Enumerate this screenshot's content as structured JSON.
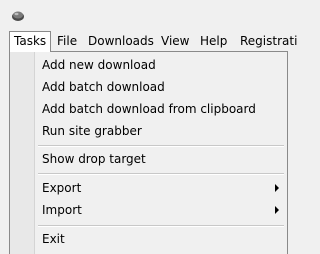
{
  "app": {
    "icon": "app-gear-icon"
  },
  "menubar": {
    "items": [
      "Tasks",
      "File",
      "Downloads",
      "View",
      "Help",
      "Registrati"
    ],
    "active": "Tasks"
  },
  "dropdown": {
    "items": [
      {
        "label": "Add new download",
        "submenu": false
      },
      {
        "label": "Add batch download",
        "submenu": false
      },
      {
        "label": "Add batch download from clipboard",
        "submenu": false
      },
      {
        "label": "Run site grabber",
        "submenu": false
      },
      {
        "label": "Show drop target",
        "submenu": false
      },
      {
        "label": "Export",
        "submenu": true,
        "icon": "chevron-right-icon"
      },
      {
        "label": "Import",
        "submenu": true,
        "icon": "chevron-right-icon"
      },
      {
        "label": "Exit",
        "submenu": false
      }
    ]
  }
}
